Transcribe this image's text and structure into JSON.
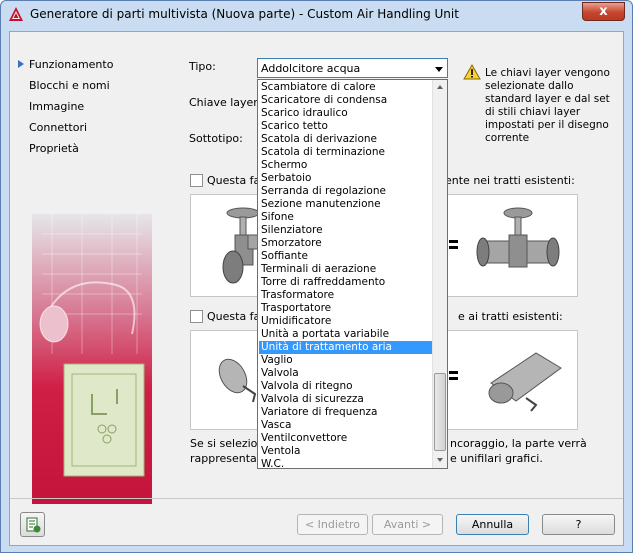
{
  "window": {
    "title": "Generatore di parti multivista (Nuova parte) - Custom Air Handling Unit",
    "close_label": "x"
  },
  "nav": {
    "items": [
      "Funzionamento",
      "Blocchi e nomi",
      "Immagine",
      "Connettori",
      "Proprietà"
    ],
    "active_index": 0
  },
  "form": {
    "tipo_label": "Tipo:",
    "tipo_value": "Addolcitore acqua",
    "chiave_label": "Chiave layer:",
    "sottotipo_label": "Sottotipo:",
    "warning_text": "Le chiavi layer vengono\nselezionate dallo\nstandard layer e dal set\ndi stili chiavi layer\nimpostati per il disegno\ncorrente",
    "check1_left": "Questa fa",
    "check1_right": "ente nei tratti esistenti:",
    "check2_left": "Questa fa",
    "check2_right": "e ai tratti esistenti:",
    "bottom_line1_left": "Se si selezion",
    "bottom_line1_right": "ncoraggio, la parte verrà",
    "bottom_line2_left": "rappresentat",
    "bottom_line2_right": "e unifilari grafici."
  },
  "dropdown": {
    "items": [
      "Scambiatore di calore",
      "Scaricatore di condensa",
      "Scarico idraulico",
      "Scarico tetto",
      "Scatola di derivazione",
      "Scatola di terminazione",
      "Schermo",
      "Serbatoio",
      "Serranda di regolazione",
      "Sezione manutenzione",
      "Sifone",
      "Silenziatore",
      "Smorzatore",
      "Soffiante",
      "Terminali di aerazione",
      "Torre di raffreddamento",
      "Trasformatore",
      "Trasportatore",
      "Umidificatore",
      "Unità a portata variabile",
      "Unità di trattamento aria",
      "Vaglio",
      "Valvola",
      "Valvola di ritegno",
      "Valvola di sicurezza",
      "Variatore di frequenza",
      "Vasca",
      "Ventilconvettore",
      "Ventola",
      "W.C."
    ],
    "selected_index": 20
  },
  "buttons": {
    "back": "< Indietro",
    "next": "Avanti >",
    "cancel": "Annulla",
    "help": "?"
  }
}
